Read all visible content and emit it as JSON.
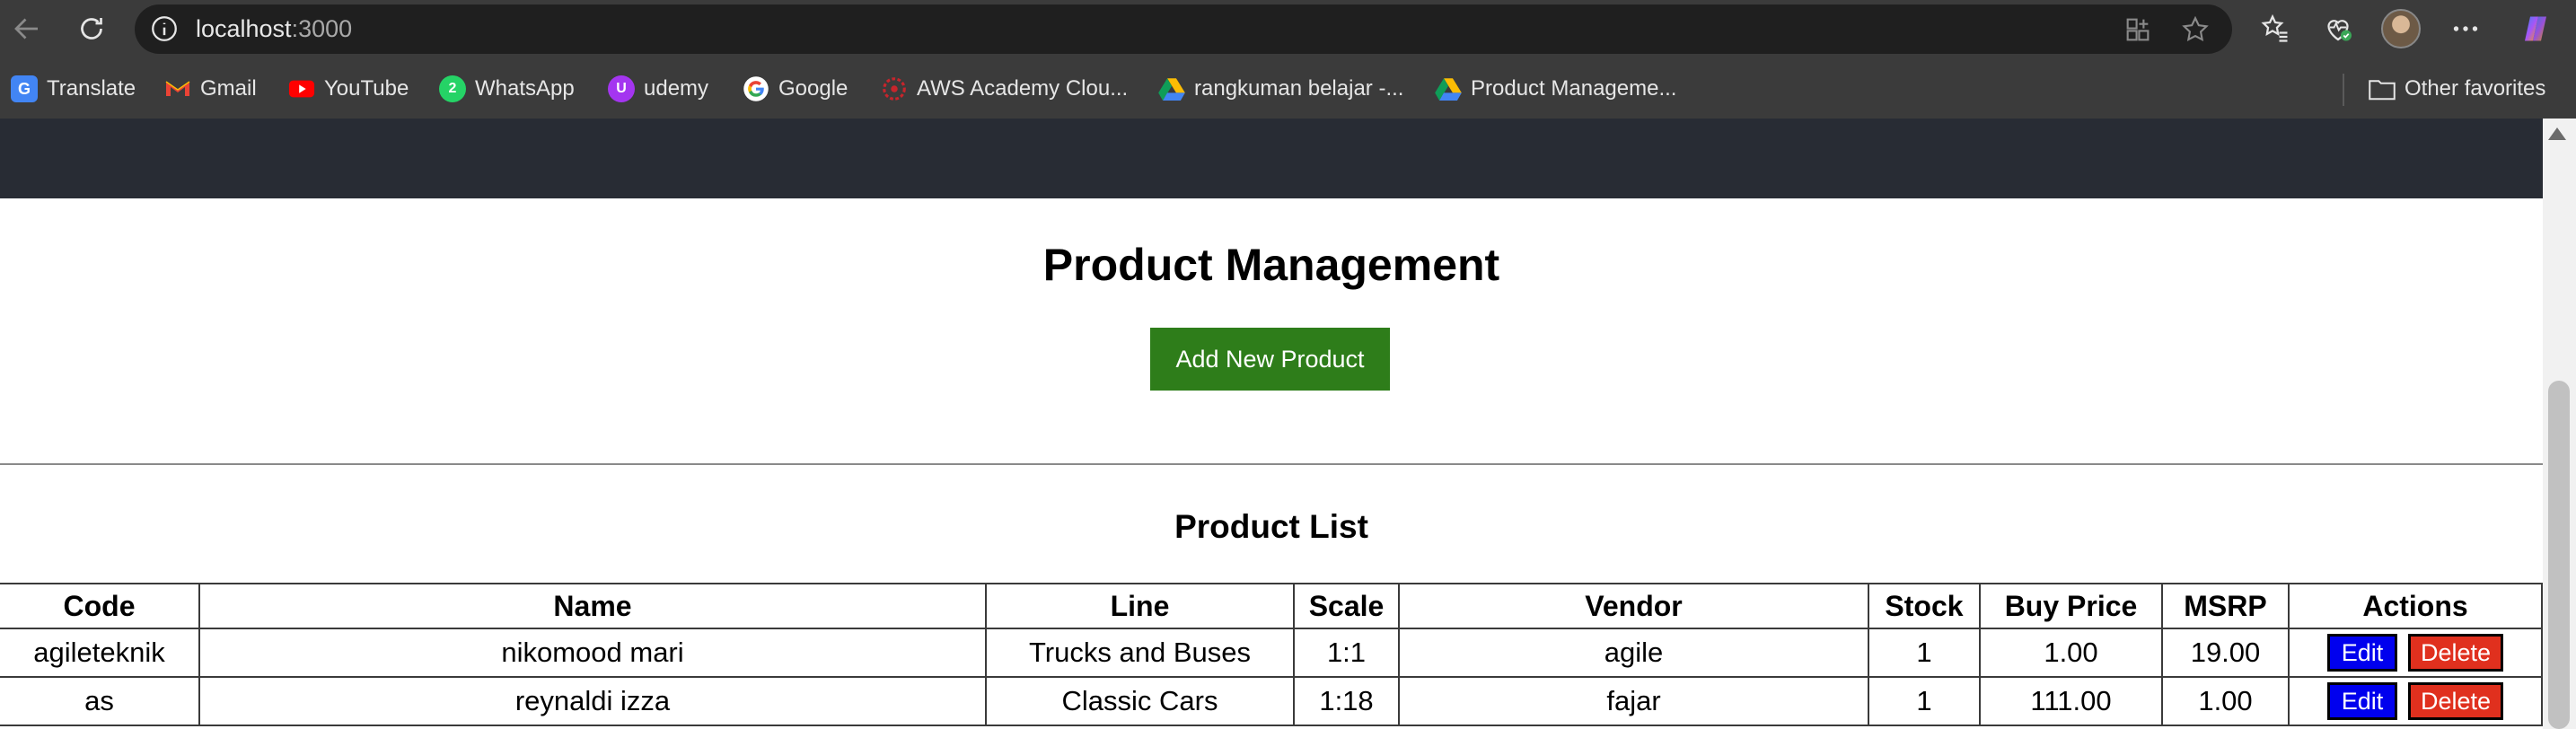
{
  "browser": {
    "url_host": "localhost",
    "url_port": ":3000",
    "bookmarks": [
      {
        "label": "Translate",
        "icon": "google-translate-icon",
        "color": "#4285f4"
      },
      {
        "label": "Gmail",
        "icon": "gmail-icon",
        "color": "#ea4335"
      },
      {
        "label": "YouTube",
        "icon": "youtube-icon",
        "color": "#ff0000"
      },
      {
        "label": "WhatsApp",
        "icon": "whatsapp-icon",
        "color": "#25d366"
      },
      {
        "label": "udemy",
        "icon": "udemy-icon",
        "color": "#a435f0"
      },
      {
        "label": "Google",
        "icon": "google-icon",
        "color": "#ffffff"
      },
      {
        "label": "AWS Academy Clou...",
        "icon": "aws-academy-icon",
        "color": "#c7252c"
      },
      {
        "label": "rangkuman belajar -...",
        "icon": "google-drive-icon",
        "color": "#fbbc04"
      },
      {
        "label": "Product Manageme...",
        "icon": "google-drive-icon",
        "color": "#fbbc04"
      }
    ],
    "other_favorites": "Other favorites"
  },
  "page": {
    "title": "Product Management",
    "add_button": "Add New Product",
    "list_title": "Product List"
  },
  "table": {
    "headers": [
      "Code",
      "Name",
      "Line",
      "Scale",
      "Vendor",
      "Stock",
      "Buy Price",
      "MSRP",
      "Actions"
    ],
    "rows": [
      {
        "code": "agileteknik",
        "name": "nikomood mari",
        "line": "Trucks and Buses",
        "scale": "1:1",
        "vendor": "agile",
        "stock": "1",
        "buy_price": "1.00",
        "msrp": "19.00"
      },
      {
        "code": "as",
        "name": "reynaldi izza",
        "line": "Classic Cars",
        "scale": "1:18",
        "vendor": "fajar",
        "stock": "1",
        "buy_price": "111.00",
        "msrp": "1.00"
      }
    ],
    "edit_label": "Edit",
    "delete_label": "Delete"
  },
  "colors": {
    "chrome": "#3b3b3b",
    "app_header": "#282c34",
    "add_button": "#2e7d1a",
    "edit_button": "#0000ee",
    "delete_button": "#e0301e"
  }
}
